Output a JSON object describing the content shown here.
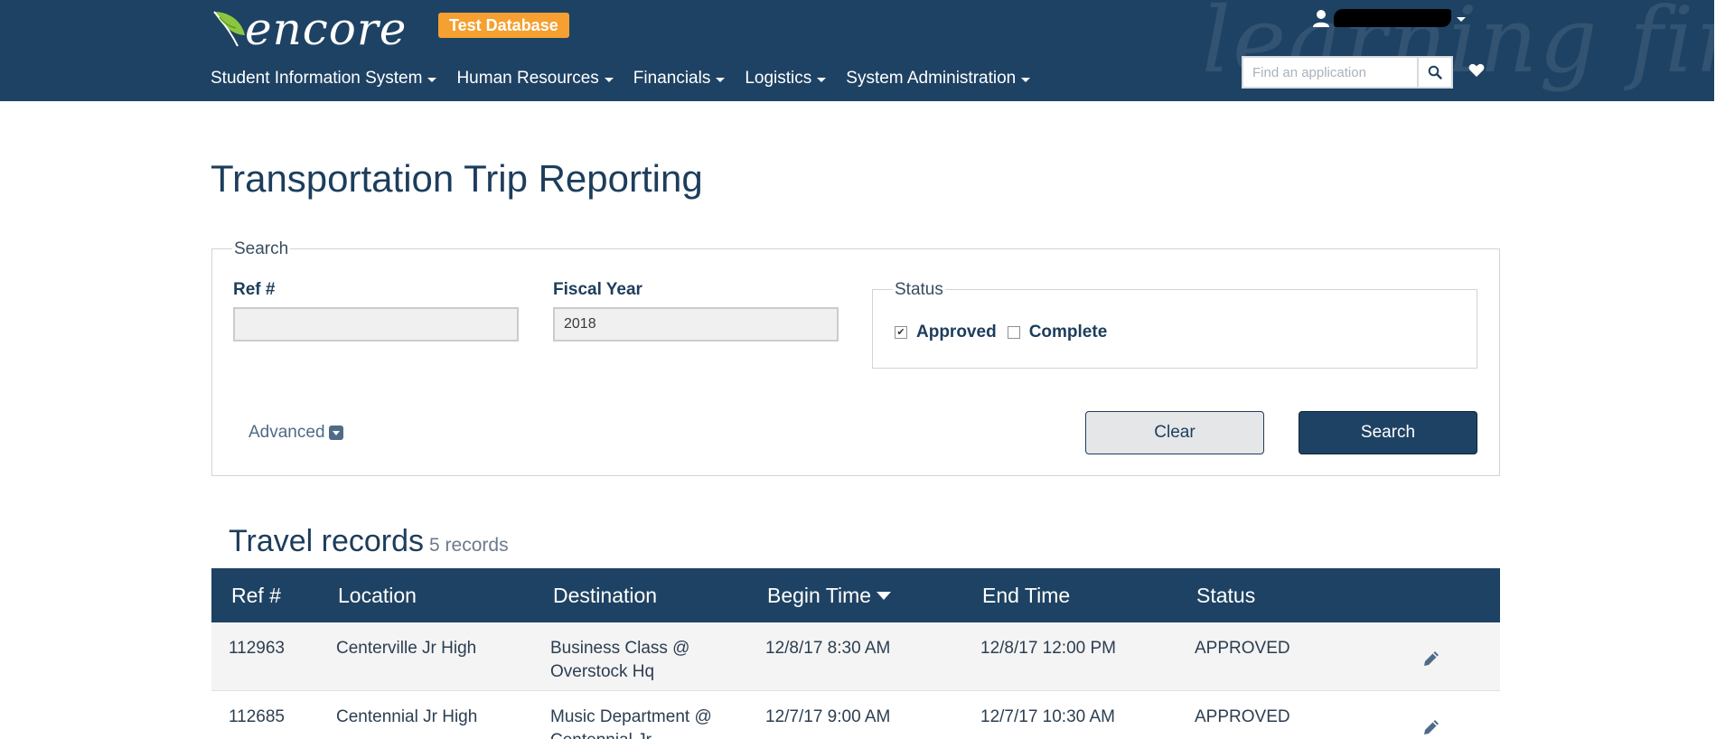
{
  "header": {
    "logo_text": "encore",
    "watermark": "learning first",
    "db_badge": "Test Database",
    "nav": [
      {
        "label": "Student Information System"
      },
      {
        "label": "Human Resources"
      },
      {
        "label": "Financials"
      },
      {
        "label": "Logistics"
      },
      {
        "label": "System Administration"
      }
    ],
    "search_placeholder": "Find an application",
    "colors": {
      "bar": "#1e4263",
      "badge": "#f5a031"
    }
  },
  "page": {
    "title": "Transportation Trip Reporting"
  },
  "search": {
    "legend": "Search",
    "ref_label": "Ref #",
    "ref_value": "",
    "fiscal_year_label": "Fiscal Year",
    "fiscal_year_value": "2018",
    "status_legend": "Status",
    "approved_label": "Approved",
    "approved_checked": true,
    "complete_label": "Complete",
    "complete_checked": false,
    "advanced_label": "Advanced",
    "clear_label": "Clear",
    "search_label": "Search"
  },
  "records": {
    "title": "Travel records",
    "count": "5 records",
    "columns": [
      "Ref #",
      "Location",
      "Destination",
      "Begin Time",
      "End Time",
      "Status"
    ],
    "sorted_column": "Begin Time",
    "rows": [
      {
        "ref": "112963",
        "location": "Centerville Jr High",
        "destination": "Business Class @ Overstock Hq",
        "begin": "12/8/17 8:30 AM",
        "end": "12/8/17 12:00 PM",
        "status": "APPROVED"
      },
      {
        "ref": "112685",
        "location": "Centennial Jr High",
        "destination": "Music Department @ Centennial Jr",
        "begin": "12/7/17 9:00 AM",
        "end": "12/7/17 10:30 AM",
        "status": "APPROVED"
      }
    ]
  }
}
